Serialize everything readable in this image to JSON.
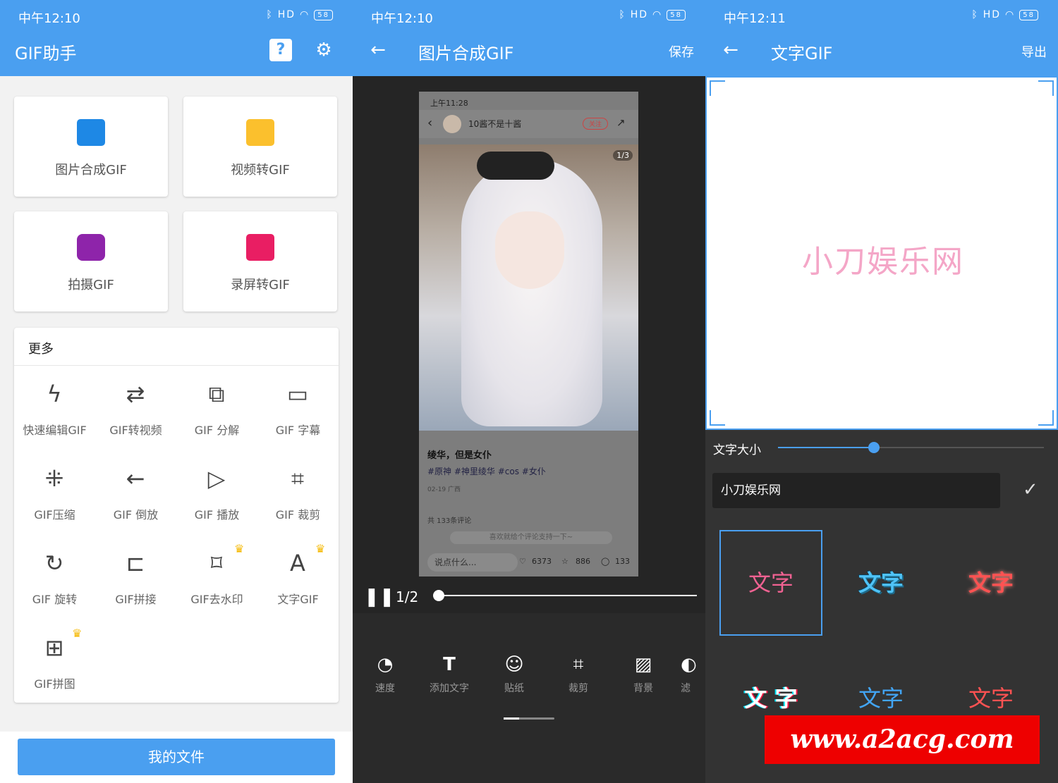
{
  "status": {
    "time1": "中午12:10",
    "time2": "中午12:10",
    "time3": "中午12:11",
    "battery": "58",
    "signal": "HD"
  },
  "screen1": {
    "title": "GIF助手",
    "help_icon": "help-icon",
    "settings_icon": "gear-icon",
    "cards": [
      {
        "label": "图片合成GIF",
        "icon": "image-icon",
        "color": "#1e88e5"
      },
      {
        "label": "视频转GIF",
        "icon": "movie-icon",
        "color": "#fbc02d"
      },
      {
        "label": "拍摄GIF",
        "icon": "camera-icon",
        "color": "#8e24aa"
      },
      {
        "label": "录屏转GIF",
        "icon": "video-icon",
        "color": "#e91e63"
      }
    ],
    "more_header": "更多",
    "tools": [
      {
        "label": "快速编辑GIF",
        "glyph": "ϟ"
      },
      {
        "label": "GIF转视频",
        "glyph": "⇄"
      },
      {
        "label": "GIF 分解",
        "glyph": "⧉"
      },
      {
        "label": "GIF 字幕",
        "glyph": "▭"
      },
      {
        "label": "GIF压缩",
        "glyph": "⁜"
      },
      {
        "label": "GIF 倒放",
        "glyph": "←"
      },
      {
        "label": "GIF 播放",
        "glyph": "▷"
      },
      {
        "label": "GIF 裁剪",
        "glyph": "⌗"
      },
      {
        "label": "GIF 旋转",
        "glyph": "↻"
      },
      {
        "label": "GIF拼接",
        "glyph": "⊏"
      },
      {
        "label": "GIF去水印",
        "glyph": "⌑"
      },
      {
        "label": "文字GIF",
        "glyph": "A"
      },
      {
        "label": "GIF拼图",
        "glyph": "⊞"
      }
    ],
    "my_files": "我的文件"
  },
  "screen2": {
    "title": "图片合成GIF",
    "save": "保存",
    "phone": {
      "time": "上午11:28",
      "name": "10酱不是十酱",
      "follow": "关注",
      "page": "1/3",
      "post_title": "绫华，但是女仆",
      "tags": "#原神 #神里绫华 #cos #女仆",
      "date": "02-19 广西",
      "comments": "共 133条评论",
      "comment_hint": "喜欢就给个评论支持一下~",
      "input": "说点什么...",
      "likes": "6373",
      "stars": "886",
      "replies": "133"
    },
    "frame": "1/2",
    "toolbar": [
      {
        "label": "速度",
        "glyph": "◔"
      },
      {
        "label": "添加文字",
        "glyph": "T"
      },
      {
        "label": "贴纸",
        "glyph": "☺"
      },
      {
        "label": "裁剪",
        "glyph": "⌗"
      },
      {
        "label": "背景",
        "glyph": "▨"
      },
      {
        "label": "滤",
        "glyph": "◐"
      }
    ]
  },
  "screen3": {
    "title": "文字GIF",
    "export": "导出",
    "canvas_text": "小刀娱乐网",
    "size_label": "文字大小",
    "size_value": 0.36,
    "input_value": "小刀娱乐网",
    "styles": [
      {
        "text": "文字",
        "color": "#f06292"
      },
      {
        "text": "文字",
        "color": "#4fc3f7"
      },
      {
        "text": "文字",
        "color": "#ff5252"
      },
      {
        "text": "文 字",
        "color": "#ffffff"
      },
      {
        "text": "文字",
        "color": "#42a5f5"
      },
      {
        "text": "文字",
        "color": "#ff5252"
      }
    ],
    "watermark": "www.a2acg.com"
  }
}
